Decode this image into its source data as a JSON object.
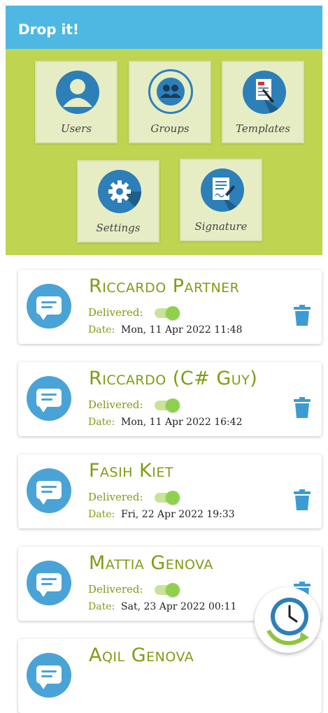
{
  "app_bar": {
    "title": "Drop it!"
  },
  "menu": {
    "users": "Users",
    "groups": "Groups",
    "templates": "Templates",
    "settings": "Settings",
    "signature": "Signature"
  },
  "cards": [
    {
      "name": "Riccardo Partner",
      "delivered_label": "Delivered:",
      "delivered": true,
      "date_label": "Date:",
      "date": "Mon, 11 Apr 2022 11:48"
    },
    {
      "name": "Riccardo (C# Guy)",
      "delivered_label": "Delivered:",
      "delivered": true,
      "date_label": "Date:",
      "date": "Mon, 11 Apr 2022 16:42"
    },
    {
      "name": "Fasih Kiet",
      "delivered_label": "Delivered:",
      "delivered": true,
      "date_label": "Date:",
      "date": "Fri, 22 Apr 2022 19:33"
    },
    {
      "name": "Mattia Genova",
      "delivered_label": "Delivered:",
      "delivered": true,
      "date_label": "Date:",
      "date": "Sat, 23 Apr 2022 00:11"
    },
    {
      "name": "Aqil Genova"
    }
  ],
  "colors": {
    "app_bar": "#4eb8e3",
    "menu_panel": "#bfd552",
    "name_text": "#7f9c14",
    "icon_blue": "#2d7fb8",
    "message_icon": "#4aa3d6",
    "trash": "#3d9bd3",
    "toggle_on": "#8fd14f"
  },
  "icons": {
    "users": "user-icon",
    "groups": "groups-icon",
    "templates": "document-icon",
    "settings": "gear-icon",
    "signature": "signature-icon",
    "card_avatar": "message-icon",
    "card_action": "trash-icon",
    "fab": "clock-icon"
  }
}
